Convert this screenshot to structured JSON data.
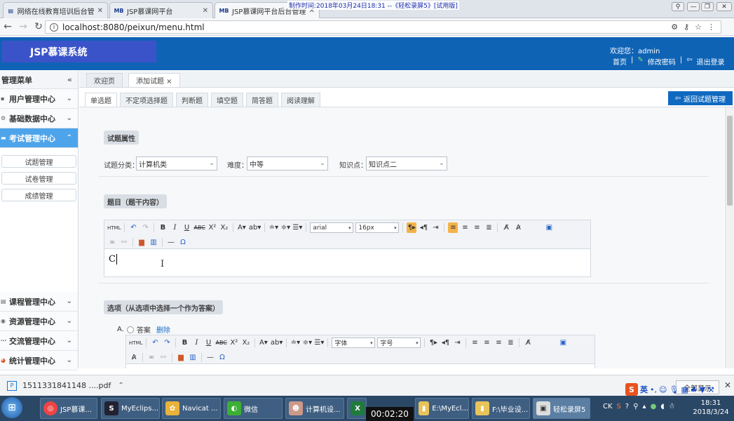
{
  "browser": {
    "tabs": [
      {
        "label": "网络在线教育培训后台管",
        "favicon": "page-icon"
      },
      {
        "label": "JSP慕课网平台",
        "favicon": "MB"
      },
      {
        "label": "JSP慕课网平台后台管理",
        "favicon": "MB"
      }
    ],
    "watermark": "制作时间:2018年03月24日18:31 --《轻松录屏5》[试用版]",
    "url": "localhost:8080/peixun/menu.html"
  },
  "header": {
    "logo": "JSP慕课系统",
    "welcome": "欢迎您：admin",
    "links": [
      "首页",
      "修改密码",
      "退出登录"
    ]
  },
  "sidebar": {
    "title": "管理菜单",
    "groups_top": [
      {
        "label": "用户管理中心"
      },
      {
        "label": "基础数据中心"
      },
      {
        "label": "考试管理中心",
        "active": true
      }
    ],
    "subitems": [
      "试题管理",
      "试卷管理",
      "成绩管理"
    ],
    "groups_bottom": [
      {
        "label": "课程管理中心"
      },
      {
        "label": "资源管理中心"
      },
      {
        "label": "交流管理中心"
      },
      {
        "label": "统计管理中心"
      }
    ]
  },
  "main": {
    "page_tabs": [
      "欢迎页",
      "添加试题 ×"
    ],
    "question_tabs": [
      "单选题",
      "不定项选择题",
      "判断题",
      "填空题",
      "简答题",
      "阅读理解"
    ],
    "back_button": "返回试题管理",
    "section_attrs": "试题属性",
    "field_category_label": "试题分类：",
    "field_category_value": "计算机类",
    "field_difficulty_label": "难度：",
    "field_difficulty_value": "中等",
    "field_knowledge_label": "知识点：",
    "field_knowledge_value": "知识点二",
    "section_stem": "题目（题干内容）",
    "editor1_font": "arial",
    "editor1_size": "16px",
    "editor1_text": "C",
    "section_options": "选项（从选项中选择一个作为答案）",
    "option_letter": "A.",
    "option_answer_label": "答案",
    "option_delete": "删除",
    "editor2_font": "字体",
    "editor2_size": "字号"
  },
  "download": {
    "filename": "1511331841148 ....pdf",
    "show_all": "全部显示"
  },
  "taskbar": {
    "buttons": [
      "JSP慕课...",
      "MyEclips...",
      "Navicat ...",
      "微信",
      "计算机设...",
      "",
      "E:\\MyEcl...",
      "F:\\毕业设...",
      "轻松录屏5"
    ],
    "timer": "00:02:20",
    "time": "18:31",
    "date": "2018/3/24",
    "ime": "英"
  },
  "colors": {
    "header_bg": "#0f63b5",
    "logo_bg": "#3b53c9",
    "active_group": "#4ea4ea",
    "button": "#1069c0"
  }
}
